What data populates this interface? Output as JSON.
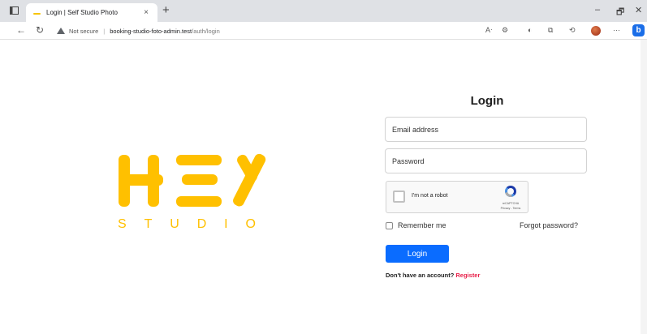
{
  "browser": {
    "tab_title": "Login | Self Studio Photo",
    "tab_close": "×",
    "new_tab": "+",
    "url_warning": "Not secure",
    "url_host": "booking-studio-foto-admin.test",
    "url_path": "/auth/login",
    "window_controls": [
      "–",
      "🗗",
      "✕"
    ],
    "more_menu": "···",
    "copilot_label": "b"
  },
  "brand": {
    "logo_word": "HEY",
    "sub_letters": [
      "S",
      "T",
      "U",
      "D",
      "I",
      "O"
    ],
    "color": "#ffc000"
  },
  "form": {
    "title": "Login",
    "email_placeholder": "Email address",
    "password_placeholder": "Password",
    "captcha_label": "I'm not a robot",
    "captcha_brand": "reCAPTCHA",
    "captcha_terms": "Privacy - Terms",
    "remember_label": "Remember me",
    "forgot_label": "Forgot password?",
    "login_button": "Login",
    "signup_prompt": "Don't have an account?",
    "signup_link": "Register",
    "accent": "#0a6cff",
    "link_color": "#e8214a"
  }
}
